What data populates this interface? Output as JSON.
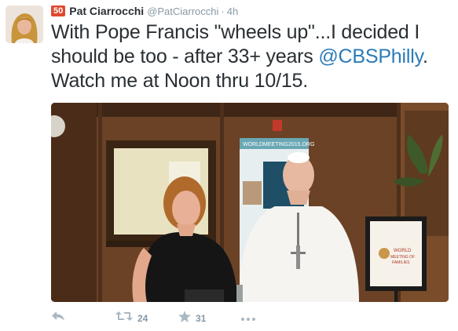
{
  "tweet": {
    "badge": "50",
    "fullname": "Pat Ciarrocchi",
    "username": "@PatCiarrocchi",
    "separator": "·",
    "time": "4h",
    "text_part1": "With Pope Francis \"wheels up\"...I decided I should be too - after 33+ years ",
    "mention": "@CBSPhilly",
    "text_part2": ". Watch me at Noon thru 10/15.",
    "photo": {
      "banner_text": "WORLDMEETING2015.ORG",
      "sign_lines": [
        "WORLD",
        "MEETING OF",
        "FAMILIES"
      ]
    },
    "actions": {
      "reply_icon": "reply-icon",
      "retweet_icon": "retweet-icon",
      "retweet_count": "24",
      "favorite_icon": "star-icon",
      "favorite_count": "31",
      "more_icon": "more-dots-icon"
    }
  },
  "colors": {
    "text": "#292f33",
    "secondary": "#8899a6",
    "link": "#2b7bb9",
    "badge": "#e0492d",
    "icon": "#aab8c2"
  }
}
